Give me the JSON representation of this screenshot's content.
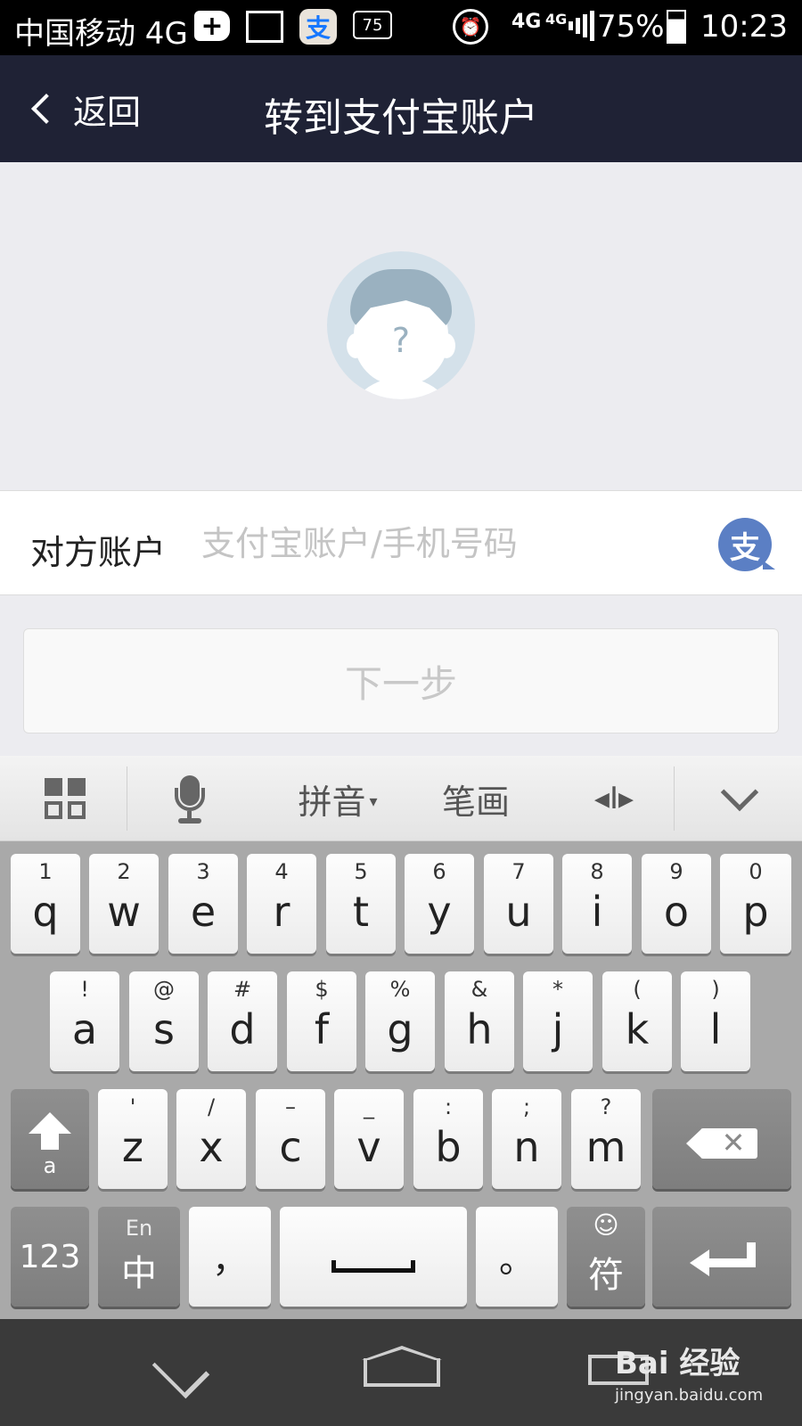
{
  "status_bar": {
    "carrier": "中国移动 4G",
    "plus_icon": "+",
    "alipay_icon": "支",
    "notif_badge": "75",
    "net_type_1": "4G",
    "net_type_2": "4G",
    "battery_percent": "75%",
    "time": "10:23"
  },
  "header": {
    "back_label": "返回",
    "title": "转到支付宝账户"
  },
  "avatar": {
    "placeholder_mark": "?"
  },
  "form": {
    "account_label": "对方账户",
    "account_placeholder": "支付宝账户/手机号码",
    "account_value": "",
    "alipay_contact_icon": "支",
    "next_label": "下一步"
  },
  "keyboard_toolbar": {
    "pinyin_label": "拼音",
    "pinyin_caret": "▾",
    "stroke_label": "笔画",
    "cursor_glyph": "◂I▸"
  },
  "keyboard": {
    "row1": [
      {
        "main": "q",
        "sub": "1"
      },
      {
        "main": "w",
        "sub": "2"
      },
      {
        "main": "e",
        "sub": "3"
      },
      {
        "main": "r",
        "sub": "4"
      },
      {
        "main": "t",
        "sub": "5"
      },
      {
        "main": "y",
        "sub": "6"
      },
      {
        "main": "u",
        "sub": "7"
      },
      {
        "main": "i",
        "sub": "8"
      },
      {
        "main": "o",
        "sub": "9"
      },
      {
        "main": "p",
        "sub": "0"
      }
    ],
    "row2": [
      {
        "main": "a",
        "sub": "!"
      },
      {
        "main": "s",
        "sub": "@"
      },
      {
        "main": "d",
        "sub": "#"
      },
      {
        "main": "f",
        "sub": "$"
      },
      {
        "main": "g",
        "sub": "%"
      },
      {
        "main": "h",
        "sub": "&"
      },
      {
        "main": "j",
        "sub": "*"
      },
      {
        "main": "k",
        "sub": "("
      },
      {
        "main": "l",
        "sub": ")"
      }
    ],
    "row3": [
      {
        "main": "z",
        "sub": "'"
      },
      {
        "main": "x",
        "sub": "/"
      },
      {
        "main": "c",
        "sub": "–"
      },
      {
        "main": "v",
        "sub": "_"
      },
      {
        "main": "b",
        "sub": ":"
      },
      {
        "main": "n",
        "sub": ";"
      },
      {
        "main": "m",
        "sub": "?"
      }
    ],
    "shift_sub": "a",
    "num_label": "123",
    "lang_sub": "En",
    "lang_main": "中",
    "comma": "，",
    "period": "。",
    "symbol_sub": "☺",
    "symbol_main": "符"
  },
  "watermark": {
    "brand": "Bai  经验",
    "site": "jingyan.baidu.com"
  }
}
